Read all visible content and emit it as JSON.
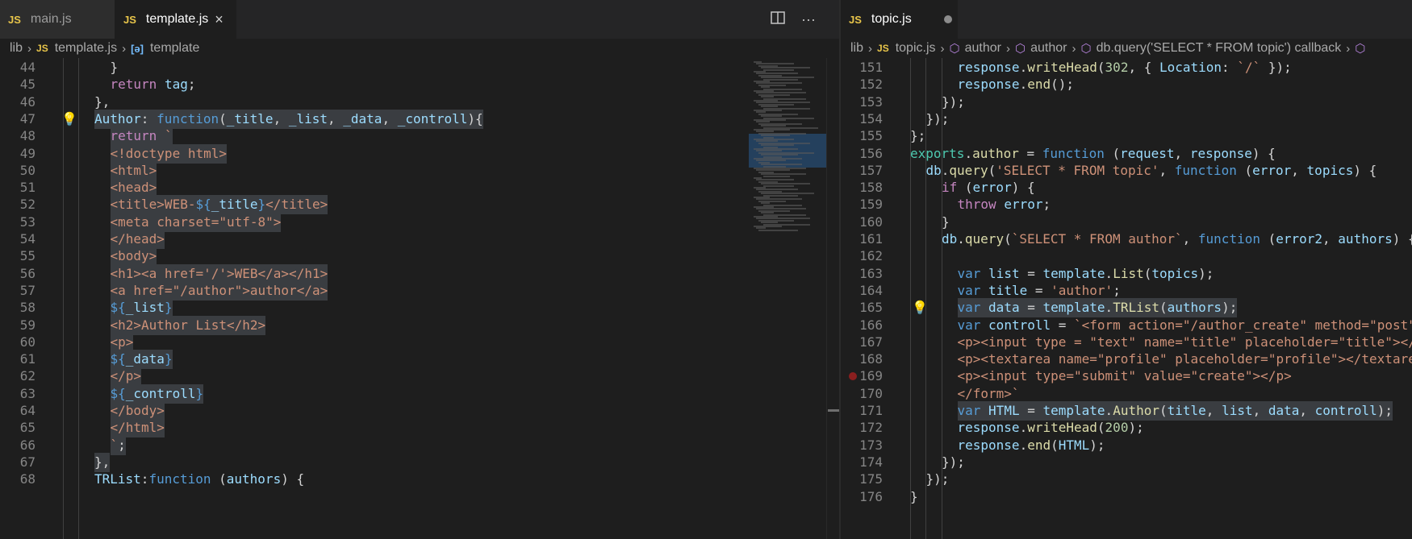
{
  "left": {
    "tabs": [
      {
        "badge": "JS",
        "label": "main.js"
      },
      {
        "badge": "JS",
        "label": "template.js",
        "close": "×"
      }
    ],
    "actions": {
      "split_icon": "split-editor-icon",
      "more": "···"
    },
    "breadcrumb": {
      "folder": "lib",
      "badge": "JS",
      "file": "template.js",
      "symbol_icon": "[ə]",
      "symbol": "template"
    },
    "lines": [
      {
        "n": "44",
        "indent": 3,
        "tokens": [
          [
            "w",
            "}"
          ]
        ]
      },
      {
        "n": "45",
        "indent": 3,
        "tokens": [
          [
            "c",
            "return"
          ],
          [
            "w",
            " "
          ],
          [
            "p",
            "tag"
          ],
          [
            "w",
            ";"
          ]
        ]
      },
      {
        "n": "46",
        "indent": 2,
        "tokens": [
          [
            "w",
            "},"
          ]
        ]
      },
      {
        "n": "47",
        "indent": 2,
        "hl": true,
        "bulb": true,
        "tokens": [
          [
            "p",
            "Author"
          ],
          [
            "w",
            ": "
          ],
          [
            "k",
            "function"
          ],
          [
            "w",
            "("
          ],
          [
            "p",
            "_title"
          ],
          [
            "w",
            ", "
          ],
          [
            "p",
            "_list"
          ],
          [
            "w",
            ", "
          ],
          [
            "p",
            "_data"
          ],
          [
            "w",
            ", "
          ],
          [
            "p",
            "_controll"
          ],
          [
            "w",
            "){"
          ]
        ]
      },
      {
        "n": "48",
        "indent": 3,
        "hl": true,
        "tokens": [
          [
            "c",
            "return"
          ],
          [
            "w",
            " "
          ],
          [
            "s",
            "`"
          ]
        ]
      },
      {
        "n": "49",
        "indent": 3,
        "hl": true,
        "tokens": [
          [
            "s",
            "<!doctype html>"
          ]
        ]
      },
      {
        "n": "50",
        "indent": 3,
        "hl": true,
        "tokens": [
          [
            "s",
            "<html>"
          ]
        ]
      },
      {
        "n": "51",
        "indent": 3,
        "hl": true,
        "tokens": [
          [
            "s",
            "<head>"
          ]
        ]
      },
      {
        "n": "52",
        "indent": 3,
        "hl": true,
        "tokens": [
          [
            "s",
            "<title>WEB-"
          ],
          [
            "k",
            "${"
          ],
          [
            "p",
            "_title"
          ],
          [
            "k",
            "}"
          ],
          [
            "s",
            "</title>"
          ]
        ]
      },
      {
        "n": "53",
        "indent": 3,
        "hl": true,
        "tokens": [
          [
            "s",
            "<meta charset=\"utf-8\">"
          ]
        ]
      },
      {
        "n": "54",
        "indent": 3,
        "hl": true,
        "tokens": [
          [
            "s",
            "</head>"
          ]
        ]
      },
      {
        "n": "55",
        "indent": 3,
        "hl": true,
        "tokens": [
          [
            "s",
            "<body>"
          ]
        ]
      },
      {
        "n": "56",
        "indent": 3,
        "hl": true,
        "tokens": [
          [
            "s",
            "<h1><a href='/'>WEB</a></h1>"
          ]
        ]
      },
      {
        "n": "57",
        "indent": 3,
        "hl": true,
        "tokens": [
          [
            "s",
            "<a href=\"/author\">author</a>"
          ]
        ]
      },
      {
        "n": "58",
        "indent": 3,
        "hl": true,
        "tokens": [
          [
            "k",
            "${"
          ],
          [
            "p",
            "_list"
          ],
          [
            "k",
            "}"
          ]
        ]
      },
      {
        "n": "59",
        "indent": 3,
        "hl": true,
        "tokens": [
          [
            "s",
            "<h2>Author List</h2>"
          ]
        ]
      },
      {
        "n": "60",
        "indent": 3,
        "hl": true,
        "tokens": [
          [
            "s",
            "<p>"
          ]
        ]
      },
      {
        "n": "61",
        "indent": 3,
        "hl": true,
        "tokens": [
          [
            "k",
            "${"
          ],
          [
            "p",
            "_data"
          ],
          [
            "k",
            "}"
          ]
        ]
      },
      {
        "n": "62",
        "indent": 3,
        "hl": true,
        "tokens": [
          [
            "s",
            "</p>"
          ]
        ]
      },
      {
        "n": "63",
        "indent": 3,
        "hl": true,
        "tokens": [
          [
            "k",
            "${"
          ],
          [
            "p",
            "_controll"
          ],
          [
            "k",
            "}"
          ]
        ]
      },
      {
        "n": "64",
        "indent": 3,
        "hl": true,
        "tokens": [
          [
            "s",
            "</body>"
          ]
        ]
      },
      {
        "n": "65",
        "indent": 3,
        "hl": true,
        "tokens": [
          [
            "s",
            "</html>"
          ]
        ]
      },
      {
        "n": "66",
        "indent": 3,
        "hl": true,
        "tokens": [
          [
            "s",
            "`"
          ],
          [
            "w",
            ";"
          ]
        ]
      },
      {
        "n": "67",
        "indent": 2,
        "hl": true,
        "tokens": [
          [
            "w",
            "},"
          ]
        ]
      },
      {
        "n": "68",
        "indent": 2,
        "tokens": [
          [
            "p",
            "TRList"
          ],
          [
            "w",
            ":"
          ],
          [
            "k",
            "function"
          ],
          [
            "w",
            " ("
          ],
          [
            "p",
            "authors"
          ],
          [
            "w",
            ") {"
          ]
        ]
      }
    ]
  },
  "right": {
    "tabs": [
      {
        "badge": "JS",
        "label": "topic.js"
      }
    ],
    "breadcrumb": {
      "folder": "lib",
      "badge": "JS",
      "file": "topic.js",
      "sym1_icon": "⬡",
      "sym1": "author",
      "sym2_icon": "⬡",
      "sym2": "author",
      "sym3_icon": "⬡",
      "sym3": "db.query('SELECT * FROM topic') callback",
      "sym4_icon": "⬡"
    },
    "lines": [
      {
        "n": "151",
        "indent": 3,
        "tokens": [
          [
            "p",
            "response"
          ],
          [
            "w",
            "."
          ],
          [
            "f",
            "writeHead"
          ],
          [
            "w",
            "("
          ],
          [
            "n",
            "302"
          ],
          [
            "w",
            ", { "
          ],
          [
            "p",
            "Location"
          ],
          [
            "w",
            ": "
          ],
          [
            "s",
            "`/`"
          ],
          [
            "w",
            " });"
          ]
        ]
      },
      {
        "n": "152",
        "indent": 3,
        "tokens": [
          [
            "p",
            "response"
          ],
          [
            "w",
            "."
          ],
          [
            "f",
            "end"
          ],
          [
            "w",
            "();"
          ]
        ]
      },
      {
        "n": "153",
        "indent": 2,
        "tokens": [
          [
            "w",
            "});"
          ]
        ]
      },
      {
        "n": "154",
        "indent": 1,
        "tokens": [
          [
            "w",
            "});"
          ]
        ]
      },
      {
        "n": "155",
        "indent": 0,
        "tokens": [
          [
            "w",
            "};"
          ]
        ]
      },
      {
        "n": "156",
        "indent": 0,
        "tokens": [
          [
            "t",
            "exports"
          ],
          [
            "w",
            "."
          ],
          [
            "f",
            "author"
          ],
          [
            "w",
            " = "
          ],
          [
            "k",
            "function"
          ],
          [
            "w",
            " ("
          ],
          [
            "p",
            "request"
          ],
          [
            "w",
            ", "
          ],
          [
            "p",
            "response"
          ],
          [
            "w",
            ") {"
          ]
        ]
      },
      {
        "n": "157",
        "indent": 1,
        "tokens": [
          [
            "p",
            "db"
          ],
          [
            "w",
            "."
          ],
          [
            "f",
            "query"
          ],
          [
            "w",
            "("
          ],
          [
            "s",
            "'SELECT * FROM topic'"
          ],
          [
            "w",
            ", "
          ],
          [
            "k",
            "function"
          ],
          [
            "w",
            " ("
          ],
          [
            "p",
            "error"
          ],
          [
            "w",
            ", "
          ],
          [
            "p",
            "topics"
          ],
          [
            "w",
            ") {"
          ]
        ]
      },
      {
        "n": "158",
        "indent": 2,
        "tokens": [
          [
            "c",
            "if"
          ],
          [
            "w",
            " ("
          ],
          [
            "p",
            "error"
          ],
          [
            "w",
            ") {"
          ]
        ]
      },
      {
        "n": "159",
        "indent": 3,
        "tokens": [
          [
            "c",
            "throw"
          ],
          [
            "w",
            " "
          ],
          [
            "p",
            "error"
          ],
          [
            "w",
            ";"
          ]
        ]
      },
      {
        "n": "160",
        "indent": 2,
        "tokens": [
          [
            "w",
            "}"
          ]
        ]
      },
      {
        "n": "161",
        "indent": 2,
        "tokens": [
          [
            "p",
            "db"
          ],
          [
            "w",
            "."
          ],
          [
            "f",
            "query"
          ],
          [
            "w",
            "("
          ],
          [
            "s",
            "`SELECT * FROM author`"
          ],
          [
            "w",
            ", "
          ],
          [
            "k",
            "function"
          ],
          [
            "w",
            " ("
          ],
          [
            "p",
            "error2"
          ],
          [
            "w",
            ", "
          ],
          [
            "p",
            "authors"
          ],
          [
            "w",
            ") {"
          ]
        ]
      },
      {
        "n": "162",
        "indent": 3,
        "tokens": []
      },
      {
        "n": "163",
        "indent": 3,
        "tokens": [
          [
            "k",
            "var"
          ],
          [
            "w",
            " "
          ],
          [
            "p",
            "list"
          ],
          [
            "w",
            " = "
          ],
          [
            "p",
            "template"
          ],
          [
            "w",
            "."
          ],
          [
            "f",
            "List"
          ],
          [
            "w",
            "("
          ],
          [
            "p",
            "topics"
          ],
          [
            "w",
            ");"
          ]
        ]
      },
      {
        "n": "164",
        "indent": 3,
        "tokens": [
          [
            "k",
            "var"
          ],
          [
            "w",
            " "
          ],
          [
            "p",
            "title"
          ],
          [
            "w",
            " = "
          ],
          [
            "s",
            "'author'"
          ],
          [
            "w",
            ";"
          ]
        ]
      },
      {
        "n": "165",
        "indent": 3,
        "hl": true,
        "bulb": true,
        "tokens": [
          [
            "k",
            "var"
          ],
          [
            "w",
            " "
          ],
          [
            "p",
            "data"
          ],
          [
            "w",
            " = "
          ],
          [
            "p",
            "template"
          ],
          [
            "w",
            "."
          ],
          [
            "f",
            "TRList"
          ],
          [
            "w",
            "("
          ],
          [
            "p",
            "authors"
          ],
          [
            "w",
            ");"
          ]
        ]
      },
      {
        "n": "166",
        "indent": 3,
        "tokens": [
          [
            "k",
            "var"
          ],
          [
            "w",
            " "
          ],
          [
            "p",
            "controll"
          ],
          [
            "w",
            " = "
          ],
          [
            "s",
            "`<form action=\"/author_create\" method=\"post\">"
          ]
        ]
      },
      {
        "n": "167",
        "indent": 3,
        "tokens": [
          [
            "s",
            "<p><input type = \"text\" name=\"title\" placeholder=\"title\"></p>"
          ]
        ]
      },
      {
        "n": "168",
        "indent": 3,
        "tokens": [
          [
            "s",
            "<p><textarea name=\"profile\" placeholder=\"profile\"></textarea></p>"
          ]
        ]
      },
      {
        "n": "169",
        "indent": 3,
        "bp": true,
        "tokens": [
          [
            "s",
            "<p><input type=\"submit\" value=\"create\"></p>"
          ]
        ]
      },
      {
        "n": "170",
        "indent": 3,
        "tokens": [
          [
            "s",
            "</form>`"
          ]
        ]
      },
      {
        "n": "171",
        "indent": 3,
        "hl": true,
        "tokens": [
          [
            "k",
            "var"
          ],
          [
            "w",
            " "
          ],
          [
            "p",
            "HTML"
          ],
          [
            "w",
            " = "
          ],
          [
            "p",
            "template"
          ],
          [
            "w",
            "."
          ],
          [
            "f",
            "Author"
          ],
          [
            "w",
            "("
          ],
          [
            "p",
            "title"
          ],
          [
            "w",
            ", "
          ],
          [
            "p",
            "list"
          ],
          [
            "w",
            ", "
          ],
          [
            "p",
            "data"
          ],
          [
            "w",
            ", "
          ],
          [
            "p",
            "controll"
          ],
          [
            "w",
            ");"
          ]
        ]
      },
      {
        "n": "172",
        "indent": 3,
        "tokens": [
          [
            "p",
            "response"
          ],
          [
            "w",
            "."
          ],
          [
            "f",
            "writeHead"
          ],
          [
            "w",
            "("
          ],
          [
            "n",
            "200"
          ],
          [
            "w",
            ");"
          ]
        ]
      },
      {
        "n": "173",
        "indent": 3,
        "tokens": [
          [
            "p",
            "response"
          ],
          [
            "w",
            "."
          ],
          [
            "f",
            "end"
          ],
          [
            "w",
            "("
          ],
          [
            "p",
            "HTML"
          ],
          [
            "w",
            ");"
          ]
        ]
      },
      {
        "n": "174",
        "indent": 2,
        "tokens": [
          [
            "w",
            "});"
          ]
        ]
      },
      {
        "n": "175",
        "indent": 1,
        "tokens": [
          [
            "w",
            "});"
          ]
        ]
      },
      {
        "n": "176",
        "indent": 0,
        "tokens": [
          [
            "w",
            "}"
          ]
        ]
      }
    ]
  }
}
